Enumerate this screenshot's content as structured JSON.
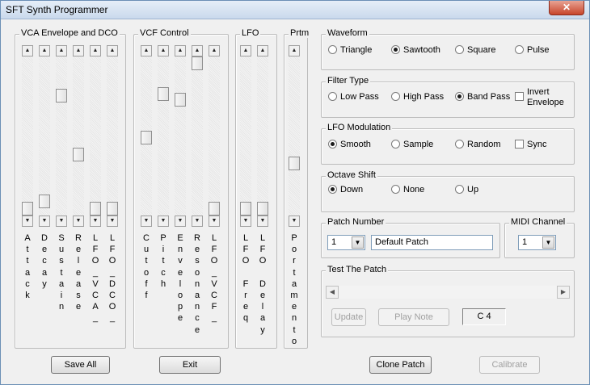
{
  "window": {
    "title": "SFT Synth Programmer",
    "close_label": "✕"
  },
  "vca": {
    "legend": "VCA Envelope and DCO",
    "labels": [
      "A\nt\nt\na\nc\nk",
      "D\ne\nc\na\ny",
      "S\nu\ns\nt\na\ni\nn",
      "R\ne\nl\ne\na\ns\ne",
      "L\nF\nO\n_\nV\nC\nA\n_",
      "L\nF\nO\n_\nD\nC\nO\n_"
    ],
    "levels": [
      0.0,
      0.05,
      0.78,
      0.37,
      0.0,
      0.0
    ]
  },
  "vcf": {
    "legend": "VCF Control",
    "labels": [
      "C\nu\nt\no\nf\nf",
      "P\ni\nt\nc\nh",
      "E\nn\nv\ne\nl\no\np\ne",
      "R\ne\ns\no\nn\na\nn\nc\ne",
      "L\nF\nO\n_\nV\nC\nF\n_"
    ],
    "levels": [
      0.49,
      0.79,
      0.75,
      1.0,
      0.0
    ]
  },
  "lfo": {
    "legend": "LFO",
    "labels": [
      "L\nF\nO\n\nF\nr\ne\nq",
      "L\nF\nO\n\nD\ne\nl\na\ny"
    ],
    "levels": [
      0.0,
      0.0
    ]
  },
  "prtm": {
    "legend": "Prtm",
    "labels": [
      "P\no\nr\nt\na\nm\ne\nn\nt\no"
    ],
    "levels": [
      0.31
    ]
  },
  "waveform": {
    "legend": "Waveform",
    "options": [
      "Triangle",
      "Sawtooth",
      "Square",
      "Pulse"
    ],
    "selected": "Sawtooth"
  },
  "filter_type": {
    "legend": "Filter Type",
    "options": [
      "Low Pass",
      "High Pass",
      "Band Pass"
    ],
    "selected": "Band Pass",
    "invert_label": "Invert\nEnvelope",
    "invert_checked": false
  },
  "lfo_mod": {
    "legend": "LFO Modulation",
    "options": [
      "Smooth",
      "Sample",
      "Random"
    ],
    "selected": "Smooth",
    "sync_label": "Sync",
    "sync_checked": false
  },
  "octave": {
    "legend": "Octave Shift",
    "options": [
      "Down",
      "None",
      "Up"
    ],
    "selected": "Down"
  },
  "patch": {
    "legend": "Patch Number",
    "number": "1",
    "name": "Default Patch"
  },
  "midi": {
    "legend": "MIDI Channel",
    "channel": "1"
  },
  "test": {
    "legend": "Test The Patch",
    "update_label": "Update",
    "play_label": "Play Note",
    "note": "C 4",
    "slider_level": 0.0
  },
  "buttons": {
    "save_all": "Save All",
    "exit": "Exit",
    "clone": "Clone Patch",
    "calibrate": "Calibrate"
  }
}
